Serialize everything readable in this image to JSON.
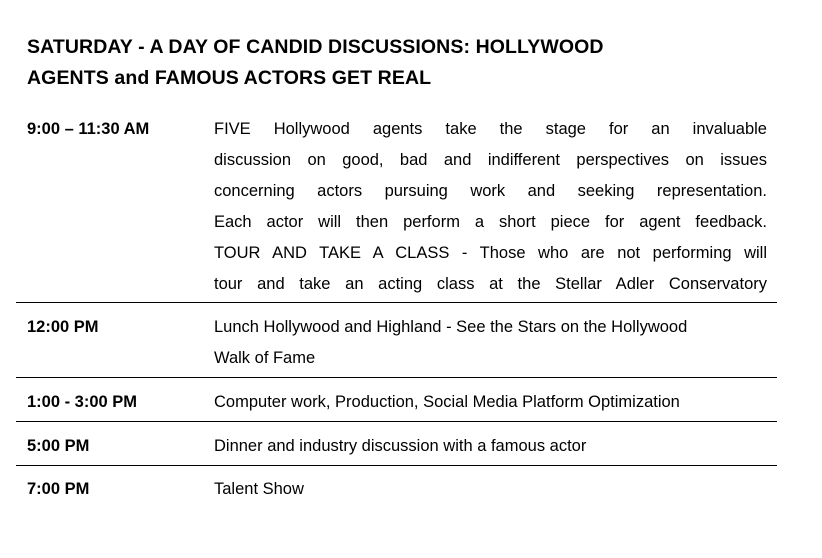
{
  "title": {
    "line1": "SATURDAY - A DAY OF CANDID DISCUSSIONS: HOLLYWOOD",
    "line2": "AGENTS and FAMOUS ACTORS GET REAL"
  },
  "schedule": [
    {
      "time": "9:00 – 11:30 AM",
      "lines": [
        "FIVE Hollywood agents take the stage for an invaluable",
        "discussion on good, bad and indifferent perspectives on issues",
        "concerning actors pursuing work and seeking representation.",
        "Each actor will then perform a short piece for agent feedback.",
        "TOUR AND TAKE A CLASS - Those who are not performing will",
        "tour and take an acting class at the Stellar Adler Conservatory"
      ]
    },
    {
      "time": "12:00 PM",
      "lines": [
        "Lunch Hollywood and Highland - See the Stars on the Hollywood",
        "Walk of Fame"
      ]
    },
    {
      "time": "1:00 - 3:00 PM",
      "lines": [
        "Computer work, Production, Social Media Platform Optimization"
      ]
    },
    {
      "time": "5:00 PM",
      "lines": [
        "Dinner and industry discussion with a famous actor"
      ]
    },
    {
      "time": "7:00 PM",
      "lines": [
        "Talent Show"
      ]
    }
  ]
}
